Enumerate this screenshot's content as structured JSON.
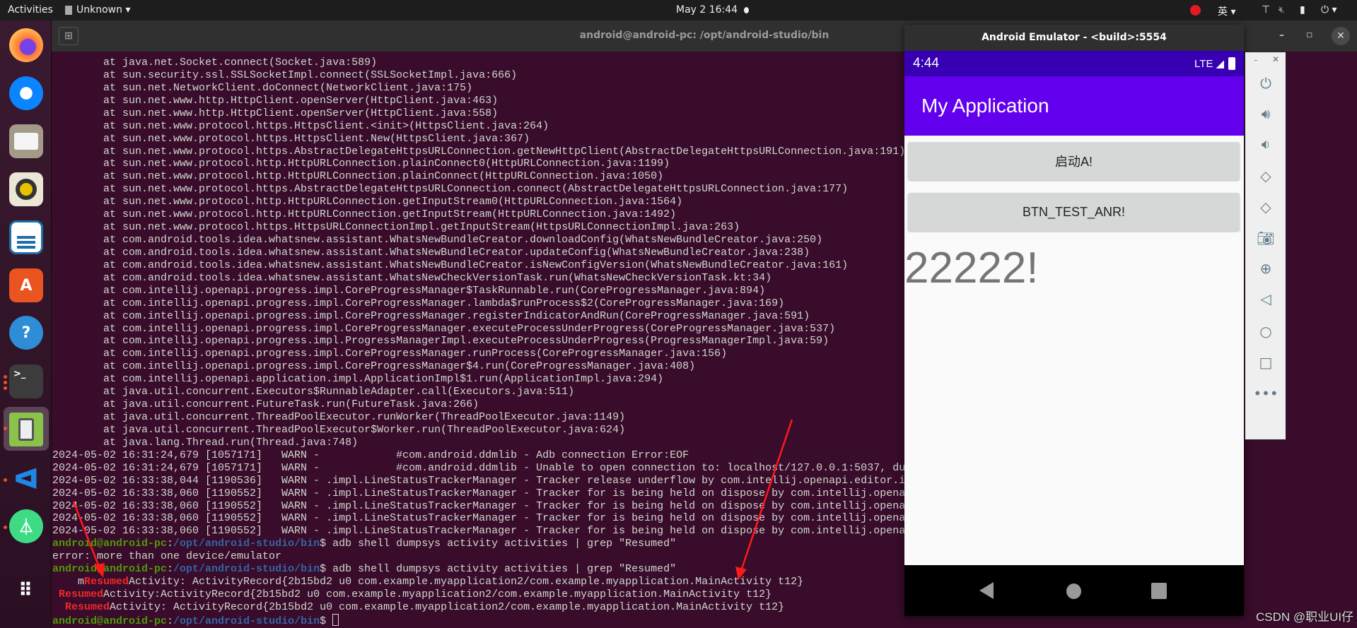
{
  "topbar": {
    "activities": "Activities",
    "app_menu": "Unknown ▾",
    "clock": "May 2  16:44",
    "input_method": "英 ▾",
    "power_menu": "⏻ ▾"
  },
  "dock": {
    "items": [
      "firefox",
      "thunderbird",
      "files",
      "rhythmbox",
      "libreoffice-writer",
      "ubuntu-software",
      "help",
      "terminal",
      "android-emulator",
      "vscode",
      "android-studio",
      "show-applications"
    ]
  },
  "terminal": {
    "title": "android@android-pc: /opt/android-studio/bin",
    "lines": [
      {
        "text": "        at java.net.Socket.connect(Socket.java:589)"
      },
      {
        "text": "        at sun.security.ssl.SSLSocketImpl.connect(SSLSocketImpl.java:666)"
      },
      {
        "text": "        at sun.net.NetworkClient.doConnect(NetworkClient.java:175)"
      },
      {
        "text": "        at sun.net.www.http.HttpClient.openServer(HttpClient.java:463)"
      },
      {
        "text": "        at sun.net.www.http.HttpClient.openServer(HttpClient.java:558)"
      },
      {
        "text": "        at sun.net.www.protocol.https.HttpsClient.<init>(HttpsClient.java:264)"
      },
      {
        "text": "        at sun.net.www.protocol.https.HttpsClient.New(HttpsClient.java:367)"
      },
      {
        "text": "        at sun.net.www.protocol.https.AbstractDelegateHttpsURLConnection.getNewHttpClient(AbstractDelegateHttpsURLConnection.java:191)"
      },
      {
        "text": "        at sun.net.www.protocol.http.HttpURLConnection.plainConnect0(HttpURLConnection.java:1199)"
      },
      {
        "text": "        at sun.net.www.protocol.http.HttpURLConnection.plainConnect(HttpURLConnection.java:1050)"
      },
      {
        "text": "        at sun.net.www.protocol.https.AbstractDelegateHttpsURLConnection.connect(AbstractDelegateHttpsURLConnection.java:177)"
      },
      {
        "text": "        at sun.net.www.protocol.http.HttpURLConnection.getInputStream0(HttpURLConnection.java:1564)"
      },
      {
        "text": "        at sun.net.www.protocol.http.HttpURLConnection.getInputStream(HttpURLConnection.java:1492)"
      },
      {
        "text": "        at sun.net.www.protocol.https.HttpsURLConnectionImpl.getInputStream(HttpsURLConnectionImpl.java:263)"
      },
      {
        "text": "        at com.android.tools.idea.whatsnew.assistant.WhatsNewBundleCreator.downloadConfig(WhatsNewBundleCreator.java:250)"
      },
      {
        "text": "        at com.android.tools.idea.whatsnew.assistant.WhatsNewBundleCreator.updateConfig(WhatsNewBundleCreator.java:238)"
      },
      {
        "text": "        at com.android.tools.idea.whatsnew.assistant.WhatsNewBundleCreator.isNewConfigVersion(WhatsNewBundleCreator.java:161)"
      },
      {
        "text": "        at com.android.tools.idea.whatsnew.assistant.WhatsNewCheckVersionTask.run(WhatsNewCheckVersionTask.kt:34)"
      },
      {
        "text": "        at com.intellij.openapi.progress.impl.CoreProgressManager$TaskRunnable.run(CoreProgressManager.java:894)"
      },
      {
        "text": "        at com.intellij.openapi.progress.impl.CoreProgressManager.lambda$runProcess$2(CoreProgressManager.java:169)"
      },
      {
        "text": "        at com.intellij.openapi.progress.impl.CoreProgressManager.registerIndicatorAndRun(CoreProgressManager.java:591)"
      },
      {
        "text": "        at com.intellij.openapi.progress.impl.CoreProgressManager.executeProcessUnderProgress(CoreProgressManager.java:537)"
      },
      {
        "text": "        at com.intellij.openapi.progress.impl.ProgressManagerImpl.executeProcessUnderProgress(ProgressManagerImpl.java:59)"
      },
      {
        "text": "        at com.intellij.openapi.progress.impl.CoreProgressManager.runProcess(CoreProgressManager.java:156)"
      },
      {
        "text": "        at com.intellij.openapi.progress.impl.CoreProgressManager$4.run(CoreProgressManager.java:408)"
      },
      {
        "text": "        at com.intellij.openapi.application.impl.ApplicationImpl$1.run(ApplicationImpl.java:294)"
      },
      {
        "text": "        at java.util.concurrent.Executors$RunnableAdapter.call(Executors.java:511)"
      },
      {
        "text": "        at java.util.concurrent.FutureTask.run(FutureTask.java:266)"
      },
      {
        "text": "        at java.util.concurrent.ThreadPoolExecutor.runWorker(ThreadPoolExecutor.java:1149)"
      },
      {
        "text": "        at java.util.concurrent.ThreadPoolExecutor$Worker.run(ThreadPoolExecutor.java:624)"
      },
      {
        "text": "        at java.lang.Thread.run(Thread.java:748)"
      },
      {
        "text": "2024-05-02 16:31:24,679 [1057171]   WARN -            #com.android.ddmlib - Adb connection Error:EOF"
      },
      {
        "text": "2024-05-02 16:31:24,679 [1057171]   WARN -            #com.android.ddmlib - Unable to open connection to: localhost/127.0.0.1:5037, du"
      },
      {
        "text": "2024-05-02 16:33:38,044 [1190536]   WARN - .impl.LineStatusTrackerManager - Tracker release underflow by com.intellij.openapi.editor.i"
      },
      {
        "text": "2024-05-02 16:33:38,060 [1190552]   WARN - .impl.LineStatusTrackerManager - Tracker for is being held on dispose by com.intellij.opena"
      },
      {
        "text": "2024-05-02 16:33:38,060 [1190552]   WARN - .impl.LineStatusTrackerManager - Tracker for is being held on dispose by com.intellij.opena"
      },
      {
        "text": "2024-05-02 16:33:38,060 [1190552]   WARN - .impl.LineStatusTrackerManager - Tracker for is being held on dispose by com.intellij.opena"
      },
      {
        "text": "2024-05-02 16:33:38,060 [1190552]   WARN - .impl.LineStatusTrackerManager - Tracker for is being held on dispose by com.intellij.opena"
      },
      {
        "user": "android@android-pc",
        "sep": ":",
        "path": "/opt/android-studio/bin",
        "cmd": "$ adb shell dumpsys activity activities | grep \"Resumed\""
      },
      {
        "text": "error: more than one device/emulator"
      },
      {
        "user": "android@android-pc",
        "sep": ":",
        "path": "/opt/android-studio/bin",
        "cmd": "$ adb shell dumpsys activity activities | grep \"Resumed\""
      },
      {
        "pre": "    m",
        "match": "Resumed",
        "post": "Activity: ActivityRecord{2b15bd2 u0 com.example.myapplication2/com.example.myapplication.MainActivity t12}"
      },
      {
        "pre": " ",
        "match": "Resumed",
        "post": "Activity:ActivityRecord{2b15bd2 u0 com.example.myapplication2/com.example.myapplication.MainActivity t12}"
      },
      {
        "pre": "  ",
        "match": "Resumed",
        "post": "Activity: ActivityRecord{2b15bd2 u0 com.example.myapplication2/com.example.myapplication.MainActivity t12}"
      },
      {
        "user": "android@android-pc",
        "sep": ":",
        "path": "/opt/android-studio/bin",
        "cmd": "$ ",
        "cursor": true
      }
    ]
  },
  "emulator": {
    "title": "Android Emulator - <build>:5554",
    "time": "4:44",
    "network": "LTE",
    "app_title": "My Application",
    "button1": "启动A!",
    "button2": "BTN_TEST_ANR!",
    "text": "22222!",
    "toolbar": [
      "power",
      "volume-up",
      "volume-down",
      "rotate-left",
      "rotate-right",
      "screenshot",
      "zoom",
      "back",
      "home",
      "overview",
      "more"
    ]
  },
  "colors": {
    "terminal_bg": "#380c2a",
    "prompt_user": "#4e9a06",
    "prompt_path": "#3465a4",
    "grep_match": "#ef2929",
    "app_bar": "#6200ee",
    "status_bar": "#3700b3",
    "annotation": "#ff1a1a"
  },
  "watermark": "CSDN @职业UI仔"
}
